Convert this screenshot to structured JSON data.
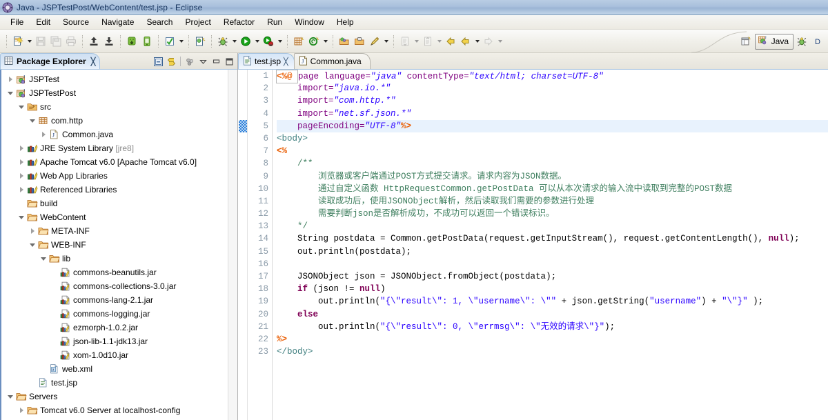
{
  "window": {
    "title": "Java - JSPTestPost/WebContent/test.jsp - Eclipse",
    "app_icon": "eclipse-icon"
  },
  "menubar": {
    "items": [
      {
        "label": "File"
      },
      {
        "label": "Edit"
      },
      {
        "label": "Source"
      },
      {
        "label": "Navigate"
      },
      {
        "label": "Search"
      },
      {
        "label": "Project"
      },
      {
        "label": "Refactor"
      },
      {
        "label": "Run"
      },
      {
        "label": "Window"
      },
      {
        "label": "Help"
      }
    ]
  },
  "toolbar": {
    "groups": [
      {
        "buttons": [
          {
            "icon": "new-wizard-icon",
            "dropdown": true
          },
          {
            "icon": "save-icon",
            "dropdown": false,
            "disabled": true
          },
          {
            "icon": "save-all-icon",
            "dropdown": false,
            "disabled": true
          },
          {
            "icon": "print-icon",
            "dropdown": false,
            "disabled": true
          }
        ]
      },
      {
        "buttons": [
          {
            "icon": "export-icon",
            "dropdown": false
          },
          {
            "icon": "import-icon",
            "dropdown": false
          }
        ]
      },
      {
        "buttons": [
          {
            "icon": "android-sdk-manager-icon",
            "dropdown": false
          },
          {
            "icon": "android-avd-manager-icon",
            "dropdown": false
          }
        ]
      },
      {
        "buttons": [
          {
            "icon": "check-mark-icon",
            "dropdown": true
          }
        ]
      },
      {
        "buttons": [
          {
            "icon": "new-java-class-icon",
            "dropdown": false
          }
        ]
      },
      {
        "buttons": [
          {
            "icon": "debug-icon",
            "dropdown": true
          },
          {
            "icon": "run-icon",
            "dropdown": true
          },
          {
            "icon": "run-external-tools-icon",
            "dropdown": true
          }
        ]
      },
      {
        "buttons": [
          {
            "icon": "new-java-package-icon",
            "dropdown": false
          },
          {
            "icon": "new-annotation-icon",
            "dropdown": true
          }
        ]
      },
      {
        "buttons": [
          {
            "icon": "open-type-icon",
            "dropdown": false
          },
          {
            "icon": "open-task-icon",
            "dropdown": false
          },
          {
            "icon": "search-pencil-icon",
            "dropdown": true
          }
        ]
      },
      {
        "buttons": [
          {
            "icon": "next-annotation-icon",
            "dropdown": true,
            "disabled": true
          },
          {
            "icon": "previous-annotation-icon",
            "dropdown": true,
            "disabled": true
          },
          {
            "icon": "back-arrow-yellow-icon",
            "dropdown": false
          },
          {
            "icon": "forward-arrow-yellow-icon",
            "dropdown": true
          },
          {
            "icon": "forward-arrow-gray-icon",
            "dropdown": true,
            "disabled": true
          }
        ]
      }
    ],
    "perspective": {
      "open_perspective_icon": "open-perspective-icon",
      "active_label": "Java",
      "active_icon": "java-perspective-icon",
      "next_icon": "debug-perspective-icon"
    }
  },
  "package_explorer": {
    "tab_label": "Package Explorer",
    "tab_icon": "package-explorer-icon",
    "close_glyph": "╳",
    "tools": [
      {
        "name": "collapse-all-icon"
      },
      {
        "name": "link-with-editor-icon"
      },
      {
        "name": "view-menu-icon"
      },
      {
        "name": "minimize-icon"
      },
      {
        "name": "maximize-icon"
      }
    ],
    "tree": [
      {
        "label": "JSPTest",
        "indent": 0,
        "twisty": "collapsed",
        "icon": "java-project-icon"
      },
      {
        "label": "JSPTestPost",
        "indent": 0,
        "twisty": "expanded",
        "icon": "java-project-icon"
      },
      {
        "label": "src",
        "indent": 1,
        "twisty": "expanded",
        "icon": "source-folder-icon"
      },
      {
        "label": "com.http",
        "indent": 2,
        "twisty": "expanded",
        "icon": "package-icon"
      },
      {
        "label": "Common.java",
        "indent": 3,
        "twisty": "collapsed",
        "icon": "java-file-icon"
      },
      {
        "label": "JRE System Library",
        "suffix": " [jre8]",
        "indent": 1,
        "twisty": "collapsed",
        "icon": "library-icon"
      },
      {
        "label": "Apache Tomcat v6.0 [Apache Tomcat v6.0]",
        "indent": 1,
        "twisty": "collapsed",
        "icon": "library-icon"
      },
      {
        "label": "Web App Libraries",
        "indent": 1,
        "twisty": "collapsed",
        "icon": "library-icon"
      },
      {
        "label": "Referenced Libraries",
        "indent": 1,
        "twisty": "collapsed",
        "icon": "library-icon"
      },
      {
        "label": "build",
        "indent": 1,
        "twisty": "none",
        "icon": "folder-icon"
      },
      {
        "label": "WebContent",
        "indent": 1,
        "twisty": "expanded",
        "icon": "folder-icon"
      },
      {
        "label": "META-INF",
        "indent": 2,
        "twisty": "collapsed",
        "icon": "folder-icon"
      },
      {
        "label": "WEB-INF",
        "indent": 2,
        "twisty": "expanded",
        "icon": "folder-icon"
      },
      {
        "label": "lib",
        "indent": 3,
        "twisty": "expanded",
        "icon": "folder-icon"
      },
      {
        "label": "commons-beanutils.jar",
        "indent": 4,
        "twisty": "none",
        "icon": "jar-icon"
      },
      {
        "label": "commons-collections-3.0.jar",
        "indent": 4,
        "twisty": "none",
        "icon": "jar-icon"
      },
      {
        "label": "commons-lang-2.1.jar",
        "indent": 4,
        "twisty": "none",
        "icon": "jar-icon"
      },
      {
        "label": "commons-logging.jar",
        "indent": 4,
        "twisty": "none",
        "icon": "jar-icon"
      },
      {
        "label": "ezmorph-1.0.2.jar",
        "indent": 4,
        "twisty": "none",
        "icon": "jar-icon"
      },
      {
        "label": "json-lib-1.1-jdk13.jar",
        "indent": 4,
        "twisty": "none",
        "icon": "jar-icon"
      },
      {
        "label": "xom-1.0d10.jar",
        "indent": 4,
        "twisty": "none",
        "icon": "jar-icon"
      },
      {
        "label": "web.xml",
        "indent": 3,
        "twisty": "none",
        "icon": "xml-file-icon"
      },
      {
        "label": "test.jsp",
        "indent": 2,
        "twisty": "none",
        "icon": "jsp-file-icon"
      },
      {
        "label": "Servers",
        "indent": 0,
        "twisty": "expanded",
        "icon": "folder-icon"
      },
      {
        "label": "Tomcat v6.0 Server at localhost-config",
        "indent": 1,
        "twisty": "collapsed",
        "icon": "folder-icon"
      }
    ]
  },
  "editor": {
    "tabs": [
      {
        "label": "test.jsp",
        "icon": "jsp-file-icon",
        "active": true,
        "close_glyph": "╳"
      },
      {
        "label": "Common.java",
        "icon": "java-file-icon",
        "active": false,
        "close_glyph": ""
      }
    ],
    "current_line": 5,
    "changed_line_marker": 5,
    "line_numbers": [
      1,
      2,
      3,
      4,
      5,
      6,
      7,
      8,
      9,
      10,
      11,
      12,
      13,
      14,
      15,
      16,
      17,
      18,
      19,
      20,
      21,
      22,
      23
    ],
    "lines": [
      {
        "n": 1,
        "tokens": [
          {
            "t": "<%@ ",
            "c": "s-jsptag"
          },
          {
            "t": "page ",
            "c": "s-attr"
          },
          {
            "t": "language=",
            "c": "s-attr"
          },
          {
            "t": "\"java\"",
            "c": "s-val"
          },
          {
            "t": " ",
            "c": "s-plain"
          },
          {
            "t": "contentType=",
            "c": "s-attr"
          },
          {
            "t": "\"text/html; charset=UTF-8\"",
            "c": "s-val"
          }
        ]
      },
      {
        "n": 2,
        "tokens": [
          {
            "t": "    import=",
            "c": "s-attr"
          },
          {
            "t": "\"java.io.*\"",
            "c": "s-val"
          }
        ]
      },
      {
        "n": 3,
        "tokens": [
          {
            "t": "    import=",
            "c": "s-attr"
          },
          {
            "t": "\"com.http.*\"",
            "c": "s-val"
          }
        ]
      },
      {
        "n": 4,
        "tokens": [
          {
            "t": "    import=",
            "c": "s-attr"
          },
          {
            "t": "\"net.sf.json.*\"",
            "c": "s-val"
          }
        ]
      },
      {
        "n": 5,
        "tokens": [
          {
            "t": "    pageEncoding=",
            "c": "s-attr"
          },
          {
            "t": "\"UTF-8\"",
            "c": "s-val"
          },
          {
            "t": "%>",
            "c": "s-jsptag"
          }
        ]
      },
      {
        "n": 6,
        "tokens": [
          {
            "t": "<body>",
            "c": "s-tag"
          }
        ]
      },
      {
        "n": 7,
        "tokens": [
          {
            "t": "<%",
            "c": "s-jsptag"
          }
        ]
      },
      {
        "n": 8,
        "tokens": [
          {
            "t": "    /**",
            "c": "s-cmt"
          }
        ]
      },
      {
        "n": 9,
        "tokens": [
          {
            "t": "        浏览器或客户端通过POST方式提交请求。请求内容为JSON数据。",
            "c": "s-cmt"
          }
        ]
      },
      {
        "n": 10,
        "tokens": [
          {
            "t": "        通过自定义函数 HttpRequestCommon.getPostData 可以从本次请求的输入流中读取到完整的POST数据",
            "c": "s-cmt"
          }
        ]
      },
      {
        "n": 11,
        "tokens": [
          {
            "t": "        读取成功后，使用JSONObject解析，然后读取我们需要的参数进行处理",
            "c": "s-cmt"
          }
        ]
      },
      {
        "n": 12,
        "tokens": [
          {
            "t": "        需要判断json是否解析成功，不成功可以返回一个错误标识。",
            "c": "s-cmt"
          }
        ]
      },
      {
        "n": 13,
        "tokens": [
          {
            "t": "    */",
            "c": "s-cmt"
          }
        ]
      },
      {
        "n": 14,
        "tokens": [
          {
            "t": "    String postdata = Common.getPostData(request.getInputStream(), request.getContentLength(), ",
            "c": "s-plain"
          },
          {
            "t": "null",
            "c": "s-kw"
          },
          {
            "t": ");",
            "c": "s-plain"
          }
        ]
      },
      {
        "n": 15,
        "tokens": [
          {
            "t": "    out.println(postdata);",
            "c": "s-plain"
          }
        ]
      },
      {
        "n": 16,
        "tokens": [
          {
            "t": "",
            "c": "s-plain"
          }
        ]
      },
      {
        "n": 17,
        "tokens": [
          {
            "t": "    JSONObject json = JSONObject.fromObject(postdata);",
            "c": "s-plain"
          }
        ]
      },
      {
        "n": 18,
        "tokens": [
          {
            "t": "    ",
            "c": "s-plain"
          },
          {
            "t": "if",
            "c": "s-kw"
          },
          {
            "t": " (json != ",
            "c": "s-plain"
          },
          {
            "t": "null",
            "c": "s-kw"
          },
          {
            "t": ")",
            "c": "s-plain"
          }
        ]
      },
      {
        "n": 19,
        "tokens": [
          {
            "t": "        out.println(",
            "c": "s-plain"
          },
          {
            "t": "\"{\\\"result\\\": 1, \\\"username\\\": \\\"\"",
            "c": "s-str"
          },
          {
            "t": " + json.getString(",
            "c": "s-plain"
          },
          {
            "t": "\"username\"",
            "c": "s-str"
          },
          {
            "t": ") + ",
            "c": "s-plain"
          },
          {
            "t": "\"\\\"}\"",
            "c": "s-str"
          },
          {
            "t": " );",
            "c": "s-plain"
          }
        ]
      },
      {
        "n": 20,
        "tokens": [
          {
            "t": "    ",
            "c": "s-plain"
          },
          {
            "t": "else",
            "c": "s-kw"
          }
        ]
      },
      {
        "n": 21,
        "tokens": [
          {
            "t": "        out.println(",
            "c": "s-plain"
          },
          {
            "t": "\"{\\\"result\\\": 0, \\\"errmsg\\\": \\\"无效的请求\\\"}\"",
            "c": "s-str"
          },
          {
            "t": ");",
            "c": "s-plain"
          }
        ]
      },
      {
        "n": 22,
        "tokens": [
          {
            "t": "%>",
            "c": "s-jsptag"
          }
        ]
      },
      {
        "n": 23,
        "tokens": [
          {
            "t": "</body>",
            "c": "s-tag"
          }
        ]
      }
    ]
  },
  "colors": {
    "title_bar": "#a9c0dc",
    "tab_active": "#d6e6f7",
    "accent_tree_border": "#6b8fc0",
    "current_line": "#e8f2fd",
    "string": "#2a00ff",
    "keyword": "#7f0055",
    "comment": "#3f7f5f",
    "jsp_tag": "#ea5c00",
    "html_tag": "#3f7f7f",
    "attribute": "#7f007f"
  }
}
